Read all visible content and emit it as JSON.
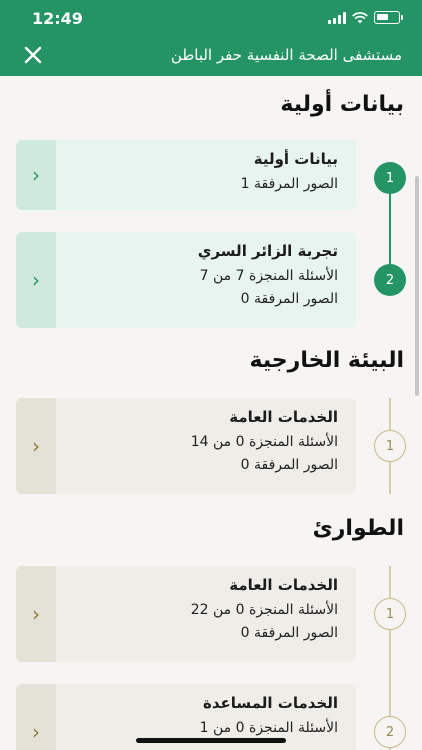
{
  "statusbar": {
    "time": "12:49",
    "battery_level": 0.6
  },
  "navbar": {
    "title": "مستشفى الصحة النفسية حفر الباطن"
  },
  "sections": [
    {
      "title": "بيانات أولية",
      "items": [
        {
          "step": "1",
          "state": "done",
          "name": "بيانات أولية",
          "lines": [
            "الصور المرفقة 1"
          ]
        },
        {
          "step": "2",
          "state": "done",
          "name": "تجربة الزائر السري",
          "lines": [
            "الأسئلة المنجزة 7 من 7",
            "الصور المرفقة 0"
          ]
        }
      ]
    },
    {
      "title": "البيئة الخارجية",
      "items": [
        {
          "step": "1",
          "state": "todo",
          "name": "الخدمات العامة",
          "lines": [
            "الأسئلة المنجزة 0 من 14",
            "الصور المرفقة 0"
          ]
        }
      ]
    },
    {
      "title": "الطوارئ",
      "items": [
        {
          "step": "1",
          "state": "todo",
          "name": "الخدمات العامة",
          "lines": [
            "الأسئلة المنجزة 0 من 22",
            "الصور المرفقة 0"
          ]
        },
        {
          "step": "2",
          "state": "todo",
          "name": "الخدمات المساعدة",
          "lines": [
            "الأسئلة المنجزة 0 من 1"
          ]
        }
      ]
    }
  ],
  "colors": {
    "brand": "#249464",
    "done_card": "#e8f4ef",
    "todo_card": "#eeede8",
    "todo_accent": "#c8b98a"
  },
  "icons": {
    "close": "close-icon",
    "chevron": "chevron-left-icon"
  }
}
